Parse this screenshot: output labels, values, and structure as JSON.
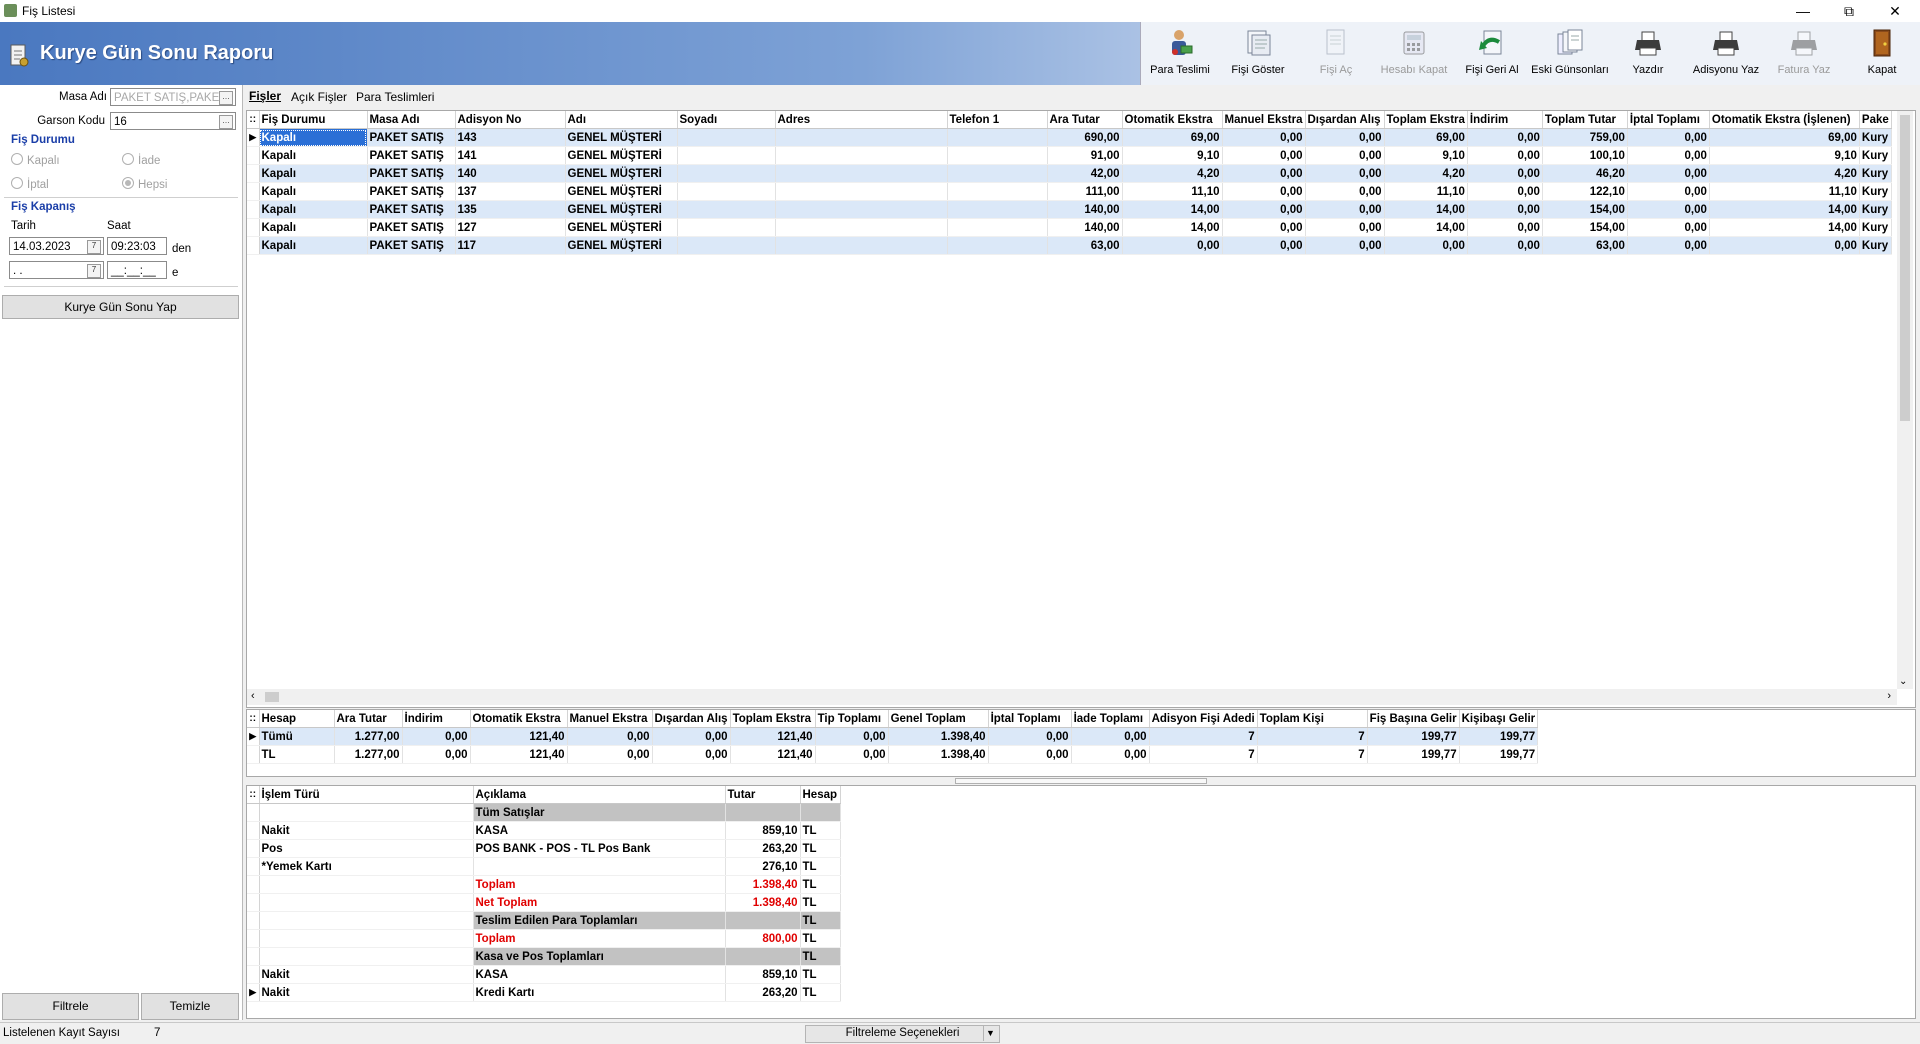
{
  "window": {
    "title": "Fiş Listesi"
  },
  "header": {
    "title": "Kurye Gün Sonu Raporu"
  },
  "toolbar": [
    {
      "label": "Para Teslimi",
      "icon": "money-handover-icon",
      "enabled": true
    },
    {
      "label": "Fişi Göster",
      "icon": "show-receipt-icon",
      "enabled": true
    },
    {
      "label": "Fişi Aç",
      "icon": "open-receipt-icon",
      "enabled": false
    },
    {
      "label": "Hesabı Kapat",
      "icon": "close-account-icon",
      "enabled": false
    },
    {
      "label": "Fişi Geri Al",
      "icon": "undo-receipt-icon",
      "enabled": true
    },
    {
      "label": "Eski Günsonları",
      "icon": "old-day-ends-icon",
      "enabled": true
    },
    {
      "label": "Yazdır",
      "icon": "printer-icon",
      "enabled": true
    },
    {
      "label": "Adisyonu Yaz",
      "icon": "print-check-icon",
      "enabled": true
    },
    {
      "label": "Fatura Yaz",
      "icon": "print-invoice-icon",
      "enabled": false
    },
    {
      "label": "Kapat",
      "icon": "exit-door-icon",
      "enabled": true
    }
  ],
  "filters": {
    "masa_label": "Masa Adı",
    "masa_value": "PAKET SATIŞ,PAKE",
    "garson_label": "Garson Kodu",
    "garson_value": "16",
    "fis_durumu_title": "Fiş Durumu",
    "radios": {
      "kapali": "Kapalı",
      "iade": "İade",
      "iptal": "İptal",
      "hepsi": "Hepsi"
    },
    "fis_kapanis_title": "Fiş Kapanış",
    "tarih_label": "Tarih",
    "saat_label": "Saat",
    "date_from": "14.03.2023",
    "time_from": "09:23:03",
    "den": "den",
    "date_to": " . .",
    "time_to": "__:__:__",
    "e": "e",
    "kurye_button": "Kurye Gün Sonu Yap",
    "filtrele": "Filtrele",
    "temizle": "Temizle"
  },
  "tabs": [
    "Fişler",
    "Açık Fişler",
    "Para Teslimleri"
  ],
  "receipts": {
    "columns": [
      "Fiş Durumu",
      "Masa Adı",
      "Adisyon No",
      "Adı",
      "Soyadı",
      "Adres",
      "Telefon 1",
      "Ara Tutar",
      "Otomatik Ekstra",
      "Manuel Ekstra",
      "Dışardan Alış",
      "Toplam Ekstra",
      "İndirim",
      "Toplam Tutar",
      "İptal Toplamı",
      "Otomatik Ekstra (İşlenen)",
      "Pake"
    ],
    "rows": [
      [
        "Kapalı",
        "PAKET SATIŞ",
        "143",
        "GENEL MÜŞTERİ",
        "",
        "",
        "",
        "690,00",
        "69,00",
        "0,00",
        "0,00",
        "69,00",
        "0,00",
        "759,00",
        "0,00",
        "69,00",
        "Kury"
      ],
      [
        "Kapalı",
        "PAKET SATIŞ",
        "141",
        "GENEL MÜŞTERİ",
        "",
        "",
        "",
        "91,00",
        "9,10",
        "0,00",
        "0,00",
        "9,10",
        "0,00",
        "100,10",
        "0,00",
        "9,10",
        "Kury"
      ],
      [
        "Kapalı",
        "PAKET SATIŞ",
        "140",
        "GENEL MÜŞTERİ",
        "",
        "",
        "",
        "42,00",
        "4,20",
        "0,00",
        "0,00",
        "4,20",
        "0,00",
        "46,20",
        "0,00",
        "4,20",
        "Kury"
      ],
      [
        "Kapalı",
        "PAKET SATIŞ",
        "137",
        "GENEL MÜŞTERİ",
        "",
        "",
        "",
        "111,00",
        "11,10",
        "0,00",
        "0,00",
        "11,10",
        "0,00",
        "122,10",
        "0,00",
        "11,10",
        "Kury"
      ],
      [
        "Kapalı",
        "PAKET SATIŞ",
        "135",
        "GENEL MÜŞTERİ",
        "",
        "",
        "",
        "140,00",
        "14,00",
        "0,00",
        "0,00",
        "14,00",
        "0,00",
        "154,00",
        "0,00",
        "14,00",
        "Kury"
      ],
      [
        "Kapalı",
        "PAKET SATIŞ",
        "127",
        "GENEL MÜŞTERİ",
        "",
        "",
        "",
        "140,00",
        "14,00",
        "0,00",
        "0,00",
        "14,00",
        "0,00",
        "154,00",
        "0,00",
        "14,00",
        "Kury"
      ],
      [
        "Kapalı",
        "PAKET SATIŞ",
        "117",
        "GENEL MÜŞTERİ",
        "",
        "",
        "",
        "63,00",
        "0,00",
        "0,00",
        "0,00",
        "0,00",
        "0,00",
        "63,00",
        "0,00",
        "0,00",
        "Kury"
      ]
    ]
  },
  "summary": {
    "columns": [
      "Hesap",
      "Ara Tutar",
      "İndirim",
      "Otomatik Ekstra",
      "Manuel Ekstra",
      "Dışardan Alış",
      "Toplam Ekstra",
      "Tip Toplamı",
      "Genel Toplam",
      "İptal Toplamı",
      "İade Toplamı",
      "Adisyon Fişi Adedi",
      "Toplam Kişi",
      "Fiş Başına Gelir",
      "Kişibaşı Gelir"
    ],
    "rows": [
      [
        "Tümü",
        "1.277,00",
        "0,00",
        "121,40",
        "0,00",
        "0,00",
        "121,40",
        "0,00",
        "1.398,40",
        "0,00",
        "0,00",
        "7",
        "7",
        "199,77",
        "199,77"
      ],
      [
        "TL",
        "1.277,00",
        "0,00",
        "121,40",
        "0,00",
        "0,00",
        "121,40",
        "0,00",
        "1.398,40",
        "0,00",
        "0,00",
        "7",
        "7",
        "199,77",
        "199,77"
      ]
    ]
  },
  "transactions": {
    "columns": [
      "İşlem Türü",
      "Açıklama",
      "Tutar",
      "Hesap"
    ],
    "rows": [
      {
        "cells": [
          "",
          "Tüm Satışlar",
          "",
          ""
        ],
        "style": "group"
      },
      {
        "cells": [
          "Nakit",
          "KASA",
          "859,10",
          "TL"
        ],
        "style": ""
      },
      {
        "cells": [
          "Pos",
          "POS BANK - POS - TL Pos Bank",
          "263,20",
          "TL"
        ],
        "style": ""
      },
      {
        "cells": [
          "*Yemek Kartı",
          "",
          "276,10",
          "TL"
        ],
        "style": ""
      },
      {
        "cells": [
          "",
          "Toplam",
          "1.398,40",
          "TL"
        ],
        "style": "red"
      },
      {
        "cells": [
          "",
          "Net Toplam",
          "1.398,40",
          "TL"
        ],
        "style": "red"
      },
      {
        "cells": [
          "",
          "Teslim Edilen Para Toplamları",
          "",
          "TL"
        ],
        "style": "group"
      },
      {
        "cells": [
          "",
          "Toplam",
          "800,00",
          "TL"
        ],
        "style": "red"
      },
      {
        "cells": [
          "",
          "Kasa ve Pos Toplamları",
          "",
          "TL"
        ],
        "style": "group"
      },
      {
        "cells": [
          "Nakit",
          "KASA",
          "859,10",
          "TL"
        ],
        "style": ""
      },
      {
        "cells": [
          "Nakit",
          "Kredi Kartı",
          "263,20",
          "TL"
        ],
        "style": "current"
      }
    ]
  },
  "status": {
    "count_label": "Listelenen Kayıt Sayısı",
    "count_value": "7",
    "filter_options": "Filtreleme Seçenekleri"
  }
}
